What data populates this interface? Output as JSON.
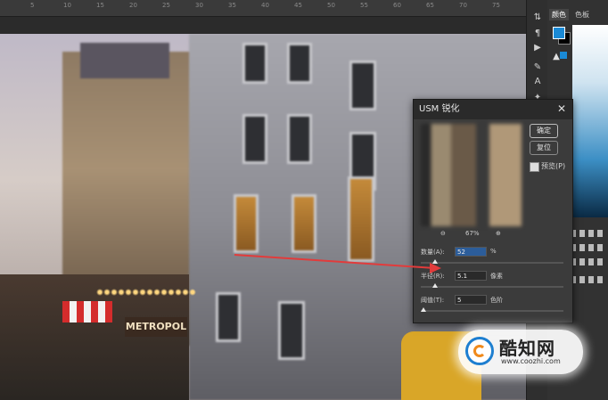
{
  "ruler": {
    "ticks": [
      "5",
      "10",
      "15",
      "20",
      "25",
      "30",
      "35",
      "40",
      "45",
      "50",
      "55",
      "60",
      "65",
      "70",
      "75"
    ]
  },
  "canvas": {
    "storefront_sign": "METROPOL"
  },
  "toolbar": {
    "tools": [
      "move-tool",
      "paragraph-tool",
      "play-tool",
      "brush-tool",
      "text-tool",
      "wand-tool"
    ]
  },
  "panel": {
    "tabs": [
      {
        "label": "颜色",
        "active": true
      },
      {
        "label": "色板",
        "active": false
      }
    ],
    "colors": {
      "foreground": "#1a8ad6",
      "background": "#000000"
    }
  },
  "dialog": {
    "title": "USM 锐化",
    "ok_label": "确定",
    "reset_label": "复位",
    "preview_label": "预览(P)",
    "preview_checked": true,
    "zoom_value": "67%",
    "fields": [
      {
        "label": "数量(A):",
        "value": "52",
        "unit": "%",
        "slider_fraction": 0.1,
        "selected": true
      },
      {
        "label": "半径(R):",
        "value": "5.1",
        "unit": "像素",
        "slider_fraction": 0.1,
        "selected": false
      },
      {
        "label": "阈值(T):",
        "value": "5",
        "unit": "色阶",
        "slider_fraction": 0.02,
        "selected": false
      }
    ]
  },
  "watermark": {
    "name": "酷知网",
    "url": "www.coozhi.com"
  },
  "annotation": {
    "arrow_color": "#e23b3b"
  }
}
